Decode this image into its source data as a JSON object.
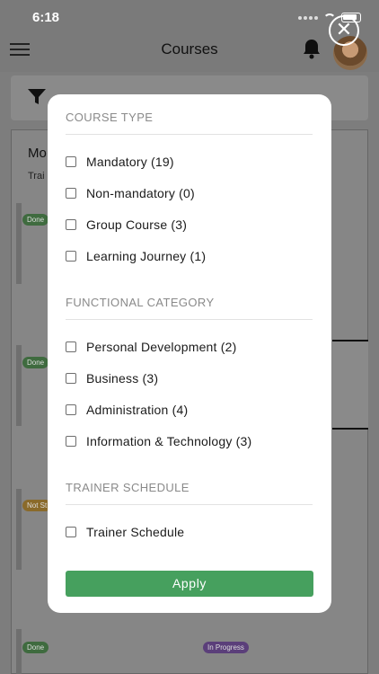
{
  "status_bar": {
    "time": "6:18"
  },
  "header": {
    "title": "Courses",
    "icons": [
      "menu-icon",
      "bell-icon",
      "avatar"
    ]
  },
  "close": {
    "glyph": "✕"
  },
  "background": {
    "heading_partial": "Mo",
    "sub_partial": "Trai",
    "badges": [
      "Done",
      "Done",
      "Not St",
      "Done",
      "In Progress"
    ],
    "colors": {
      "done": "#3f6b3f",
      "in_progress": "#5b3f7a",
      "not_started": "#8a6a2a"
    }
  },
  "filter_modal": {
    "sections": [
      {
        "title": "COURSE TYPE",
        "options": [
          "Mandatory (19)",
          "Non-mandatory (0)",
          "Group Course (3)",
          "Learning Journey (1)"
        ]
      },
      {
        "title": "FUNCTIONAL CATEGORY",
        "options": [
          "Personal Development (2)",
          "Business (3)",
          "Administration (4)",
          "Information & Technology (3)"
        ]
      },
      {
        "title": "TRAINER SCHEDULE",
        "options": [
          "Trainer Schedule"
        ]
      }
    ],
    "apply_label": "Apply",
    "colors": {
      "apply": "#46a05e",
      "section_title": "#8a8a8a"
    }
  }
}
